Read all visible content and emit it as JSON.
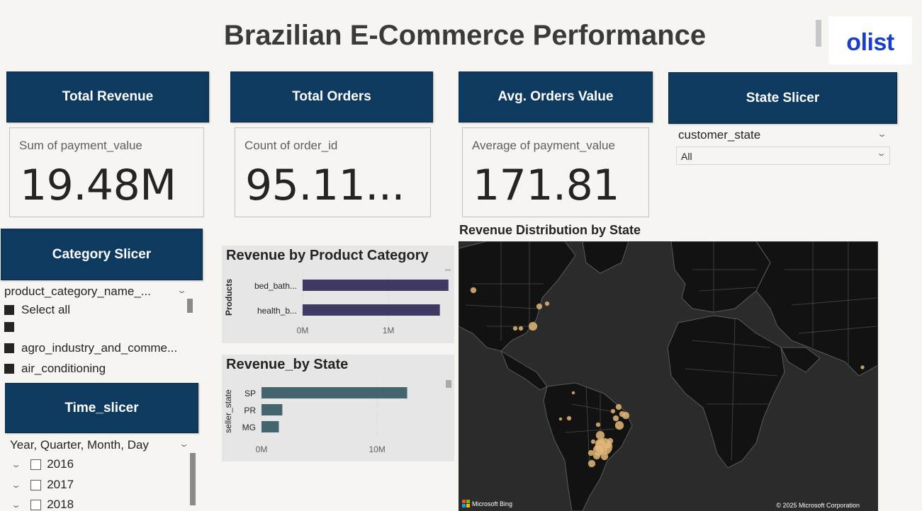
{
  "header": {
    "title": "Brazilian E-Commerce Performance",
    "logo_text": "olist"
  },
  "kpis": [
    {
      "title": "Total Revenue",
      "label": "Sum of payment_value",
      "value": "19.48M"
    },
    {
      "title": "Total Orders",
      "label": "Count of order_id",
      "value": "95.11..."
    },
    {
      "title": "Avg. Orders Value",
      "label": "Average of payment_value",
      "value": "171.81"
    }
  ],
  "state_slicer": {
    "title": "State Slicer",
    "field": "customer_state",
    "selected": "All"
  },
  "category_slicer": {
    "title": "Category Slicer",
    "field": "product_category_name_...",
    "items": [
      "Select all",
      "",
      "agro_industry_and_comme...",
      "air_conditioning"
    ]
  },
  "time_slicer": {
    "title": "Time_slicer",
    "field": "Year, Quarter, Month, Day",
    "years": [
      "2016",
      "2017",
      "2018"
    ]
  },
  "map": {
    "title": "Revenue Distribution by State",
    "attribution_left": "Microsoft Bing",
    "attribution_right": "© 2025 Microsoft Corporation",
    "colors": {
      "bubble": "#e3b97a",
      "land": "#141414",
      "water": "#2d2d2d"
    }
  },
  "chart_data": [
    {
      "type": "bar",
      "orientation": "horizontal",
      "title": "Revenue by Product Category",
      "ylabel": "Products",
      "categories": [
        "bed_bath...",
        "health_b..."
      ],
      "values": [
        1.7,
        1.6
      ],
      "x_ticks": [
        "0M",
        "1M"
      ],
      "xlim": [
        0,
        1.9
      ],
      "color": "#3f3a64"
    },
    {
      "type": "bar",
      "orientation": "horizontal",
      "title": "Revenue_by State",
      "ylabel": "seller_state",
      "categories": [
        "SP",
        "PR",
        "MG"
      ],
      "values": [
        12.6,
        1.8,
        1.5
      ],
      "x_ticks": [
        "0M",
        "10M"
      ],
      "xlim": [
        0,
        16
      ],
      "color": "#44656d"
    }
  ]
}
